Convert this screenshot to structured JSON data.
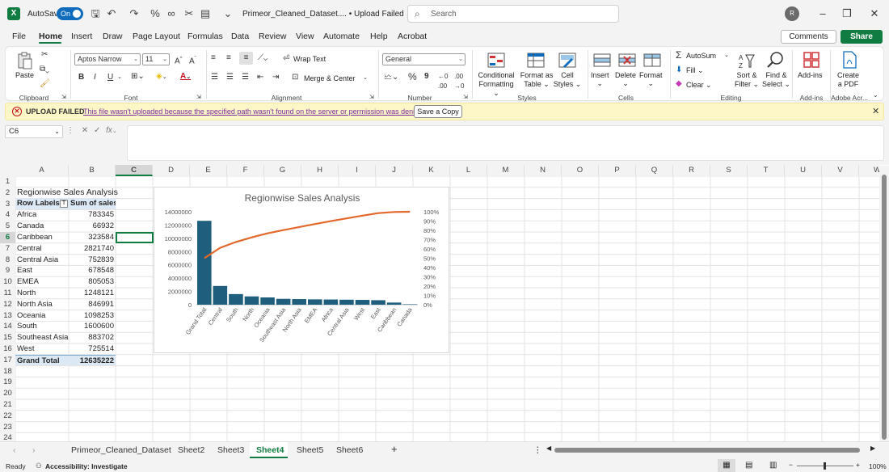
{
  "titlebar": {
    "autosave_label": "AutoSave",
    "autosave_state": "On",
    "doc_title": "Primeor_Cleaned_Dataset.... • Upload Failed ⌄",
    "search_placeholder": "Search",
    "avatar_initial": "R"
  },
  "menu": {
    "items": [
      "File",
      "Home",
      "Insert",
      "Draw",
      "Page Layout",
      "Formulas",
      "Data",
      "Review",
      "View",
      "Automate",
      "Help",
      "Acrobat"
    ],
    "comments": "Comments",
    "share": "Share"
  },
  "ribbon": {
    "clipboard": {
      "paste": "Paste",
      "label": "Clipboard"
    },
    "font": {
      "name": "Aptos Narrow",
      "size": "11",
      "label": "Font"
    },
    "alignment": {
      "wrap": "Wrap Text",
      "merge": "Merge & Center",
      "label": "Alignment"
    },
    "number": {
      "format": "General",
      "label": "Number"
    },
    "styles": {
      "conditional": [
        "Conditional",
        "Formatting ⌄"
      ],
      "format_table": [
        "Format as",
        "Table ⌄"
      ],
      "cell_styles": [
        "Cell",
        "Styles ⌄"
      ],
      "label": "Styles"
    },
    "cells": {
      "insert": "Insert",
      "delete": "Delete",
      "format": "Format",
      "label": "Cells"
    },
    "editing": {
      "autosum": "AutoSum",
      "fill": "Fill",
      "clear": "Clear",
      "sort": [
        "Sort &",
        "Filter ⌄"
      ],
      "find": [
        "Find &",
        "Select ⌄"
      ],
      "label": "Editing"
    },
    "addins": {
      "btn": "Add-ins",
      "label": "Add-ins"
    },
    "acrobat": {
      "btn": [
        "Create",
        "a PDF"
      ],
      "label": "Adobe Acr..."
    }
  },
  "message_bar": {
    "title": "UPLOAD FAILED",
    "text": "This file wasn't uploaded because the specified path wasn't found on the server or permission was denied.",
    "button": "Save a Copy"
  },
  "formula_bar": {
    "name_box": "C6",
    "fx": "fx",
    "value": ""
  },
  "columns": [
    "A",
    "B",
    "C",
    "D",
    "E",
    "F",
    "G",
    "H",
    "I",
    "J",
    "K",
    "L",
    "M",
    "N",
    "O",
    "P",
    "Q",
    "R",
    "S",
    "T",
    "U",
    "V",
    "W"
  ],
  "rows": [
    "1",
    "2",
    "3",
    "4",
    "5",
    "6",
    "7",
    "8",
    "9",
    "10",
    "11",
    "12",
    "13",
    "14",
    "15",
    "16",
    "17",
    "18",
    "19",
    "20",
    "21",
    "22",
    "23",
    "24"
  ],
  "pivot": {
    "title": "Regionwise Sales Analysis",
    "header_labels": "Row Labels",
    "header_sum": "Sum of sales",
    "rows": [
      {
        "label": "Africa",
        "value": "783345"
      },
      {
        "label": "Canada",
        "value": "66932"
      },
      {
        "label": "Caribbean",
        "value": "323584"
      },
      {
        "label": "Central",
        "value": "2821740"
      },
      {
        "label": "Central Asia",
        "value": "752839"
      },
      {
        "label": "East",
        "value": "678548"
      },
      {
        "label": "EMEA",
        "value": "805053"
      },
      {
        "label": "North",
        "value": "1248121"
      },
      {
        "label": "North Asia",
        "value": "846991"
      },
      {
        "label": "Oceania",
        "value": "1098253"
      },
      {
        "label": "South",
        "value": "1600600"
      },
      {
        "label": "Southeast Asia",
        "value": "883702"
      },
      {
        "label": "West",
        "value": "725514"
      }
    ],
    "total_label": "Grand Total",
    "total_value": "12635222"
  },
  "chart_data": {
    "type": "bar",
    "title": "Regionwise Sales Analysis",
    "categories": [
      "Grand Total",
      "Central",
      "South",
      "North",
      "Oceania",
      "Southeast Asia",
      "North Asia",
      "EMEA",
      "Africa",
      "Central Asia",
      "West",
      "East",
      "Caribbean",
      "Canada"
    ],
    "series": [
      {
        "type": "bar",
        "values": [
          12635222,
          2821740,
          1600600,
          1248121,
          1098253,
          883702,
          846991,
          805053,
          783345,
          752839,
          725514,
          678548,
          323584,
          66932
        ],
        "color": "#1f5f7d"
      },
      {
        "type": "line",
        "axis": "secondary",
        "values": [
          50,
          61.2,
          67.5,
          72.4,
          76.8,
          80.3,
          83.6,
          86.8,
          89.9,
          92.9,
          95.8,
          98.5,
          99.7,
          100
        ],
        "color": "#e2692b"
      }
    ],
    "y_ticks": [
      "0",
      "2000000",
      "4000000",
      "6000000",
      "8000000",
      "10000000",
      "12000000",
      "14000000"
    ],
    "ylim": [
      0,
      14000000
    ],
    "y2_ticks": [
      "0%",
      "10%",
      "20%",
      "30%",
      "40%",
      "50%",
      "60%",
      "70%",
      "80%",
      "90%",
      "100%"
    ],
    "y2lim": [
      0,
      100
    ]
  },
  "sheets": [
    "Primeor_Cleaned_Dataset",
    "Sheet2",
    "Sheet3",
    "Sheet4",
    "Sheet5",
    "Sheet6"
  ],
  "active_sheet": "Sheet4",
  "status": {
    "ready": "Ready",
    "accessibility": "Accessibility: Investigate",
    "zoom": "100%"
  }
}
